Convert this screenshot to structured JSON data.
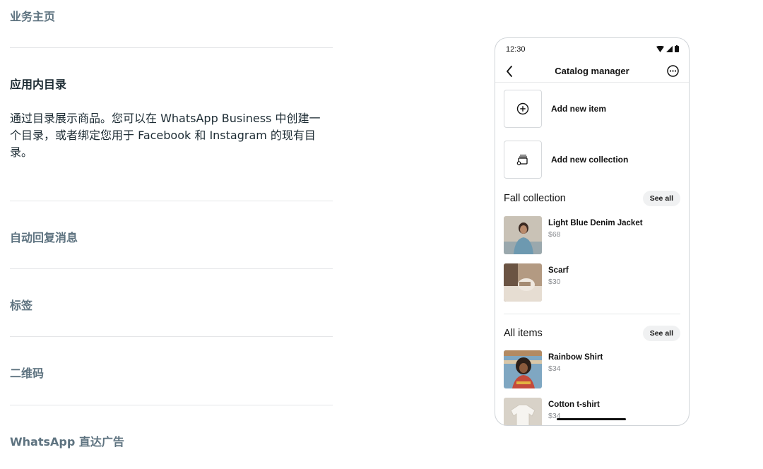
{
  "accordion": {
    "items": [
      {
        "title": "业务主页"
      },
      {
        "title": "应用内目录",
        "body": "通过目录展示商品。您可以在 WhatsApp Business 中创建一个目录，或者绑定您用于 Facebook 和 Instagram 的现有目录。"
      },
      {
        "title": "自动回复消息"
      },
      {
        "title": "标签"
      },
      {
        "title": "二维码"
      },
      {
        "title": "WhatsApp 直达广告"
      }
    ]
  },
  "phone": {
    "status_time": "12:30",
    "header_title": "Catalog manager",
    "actions": [
      {
        "label": "Add new item",
        "icon": "plus-circle-icon"
      },
      {
        "label": "Add new collection",
        "icon": "collection-stack-icon"
      }
    ],
    "sections": [
      {
        "title": "Fall collection",
        "see_all": "See all",
        "products": [
          {
            "name": "Light Blue Denim Jacket",
            "price": "$68"
          },
          {
            "name": "Scarf",
            "price": "$30"
          }
        ]
      },
      {
        "title": "All items",
        "see_all": "See all",
        "products": [
          {
            "name": "Rainbow Shirt",
            "price": "$34"
          },
          {
            "name": "Cotton t-shirt",
            "price": "$34"
          }
        ]
      }
    ]
  }
}
